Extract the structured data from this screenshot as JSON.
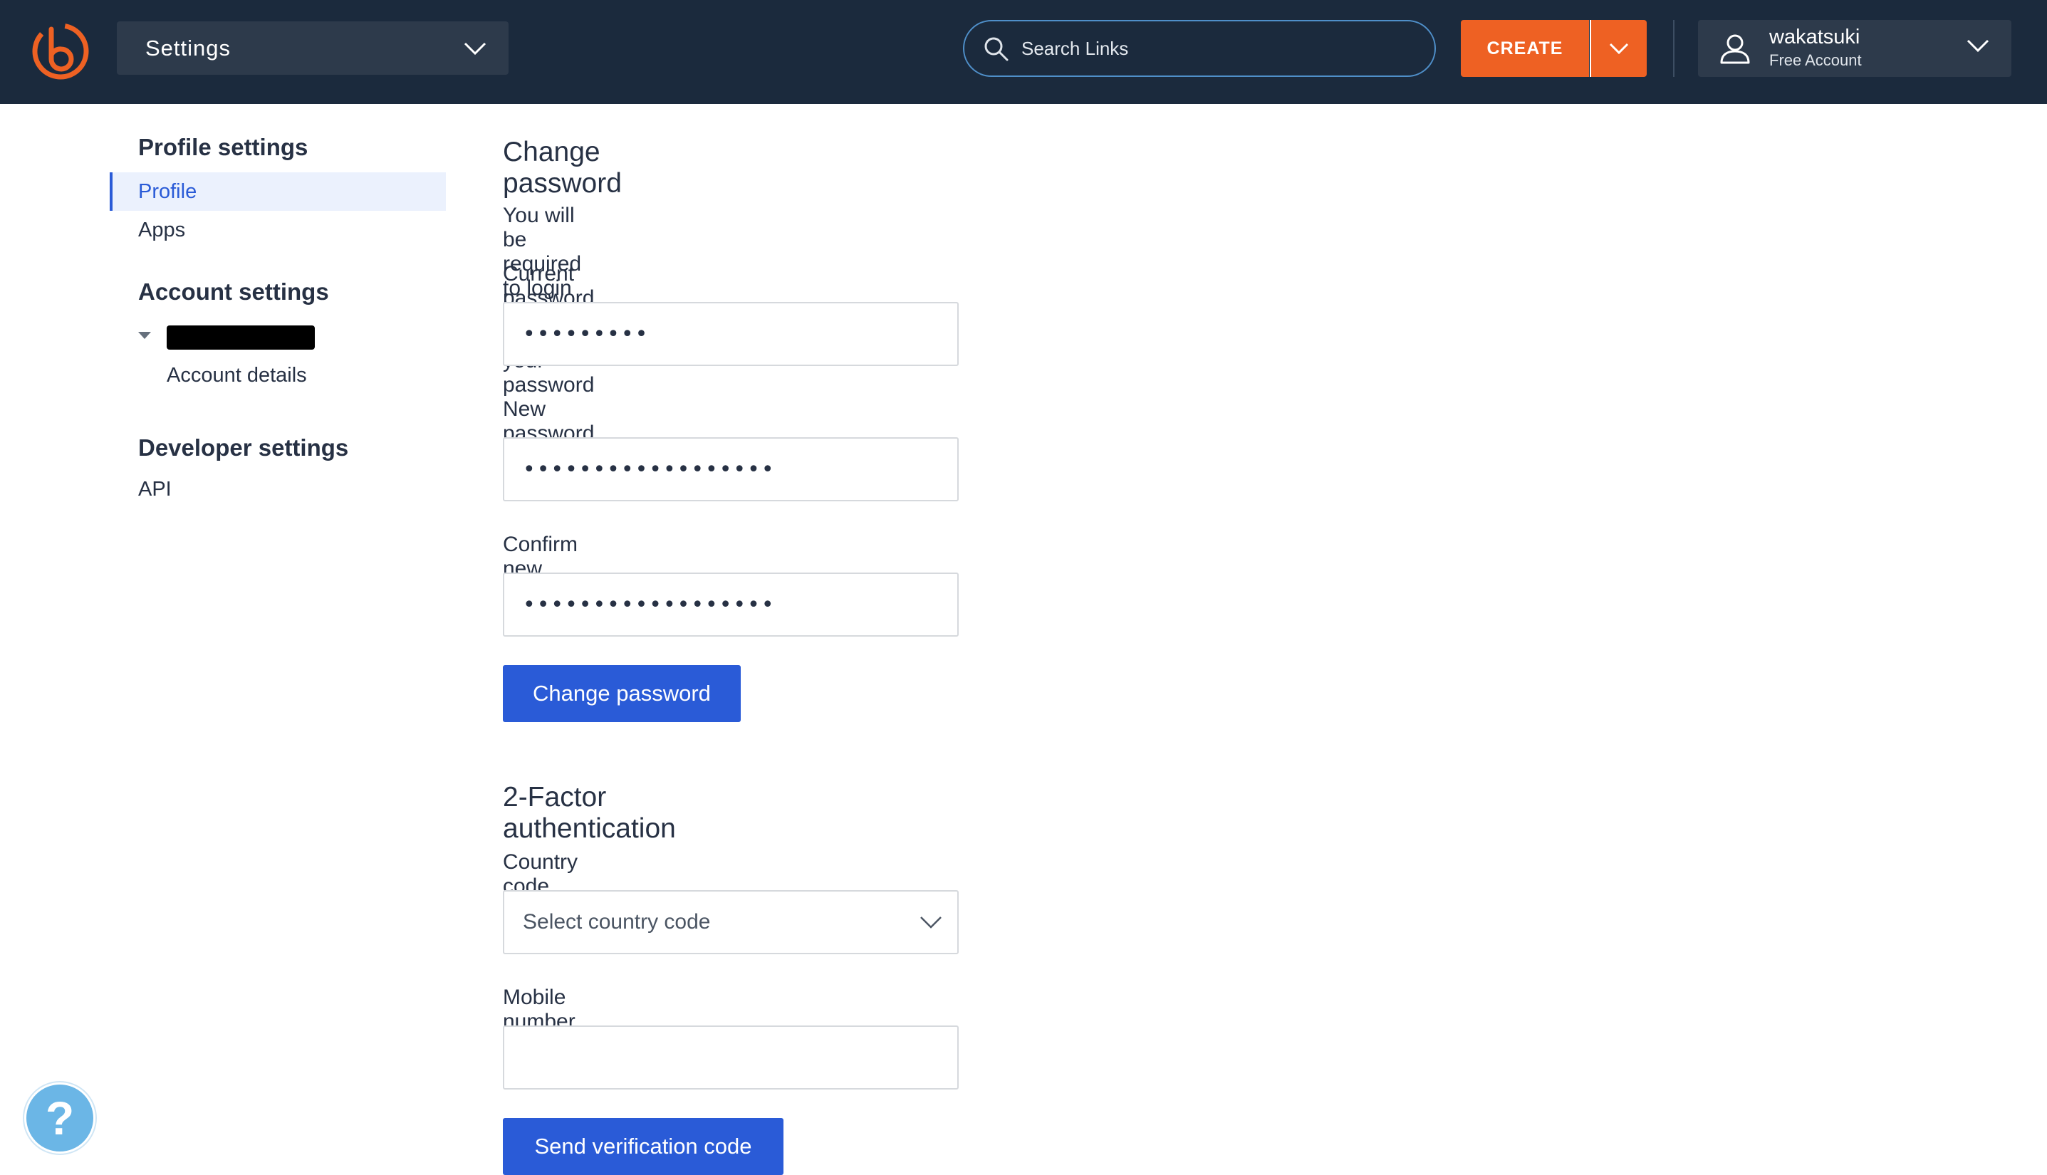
{
  "header": {
    "page_switcher_label": "Settings",
    "search_placeholder": "Search Links",
    "create_label": "CREATE",
    "account_name": "wakatsuki",
    "account_plan": "Free Account"
  },
  "sidebar": {
    "profile_heading": "Profile settings",
    "profile_items": [
      "Profile",
      "Apps"
    ],
    "active_item": "Profile",
    "account_heading": "Account settings",
    "account_sub_item": "Account details",
    "developer_heading": "Developer settings",
    "developer_items": [
      "API"
    ]
  },
  "change_password": {
    "title": "Change password",
    "note": "You will be required to login after changing your password",
    "current_label": "Current password",
    "current_value": "•••••••••",
    "new_label": "New password",
    "new_value": "••••••••••••••••••",
    "confirm_label": "Confirm new password",
    "confirm_value": "••••••••••••••••••",
    "button_label": "Change password"
  },
  "two_factor": {
    "title": "2-Factor authentication",
    "country_label": "Country code",
    "country_selected": "Select country code",
    "mobile_label": "Mobile number",
    "mobile_value": "",
    "button_label": "Send verification code"
  },
  "help": {
    "label": "?"
  },
  "colors": {
    "nav_bg": "#1b2a3d",
    "brand_orange": "#ee6123",
    "primary_blue": "#2a5bd7",
    "help_blue": "#6bb6e6"
  }
}
